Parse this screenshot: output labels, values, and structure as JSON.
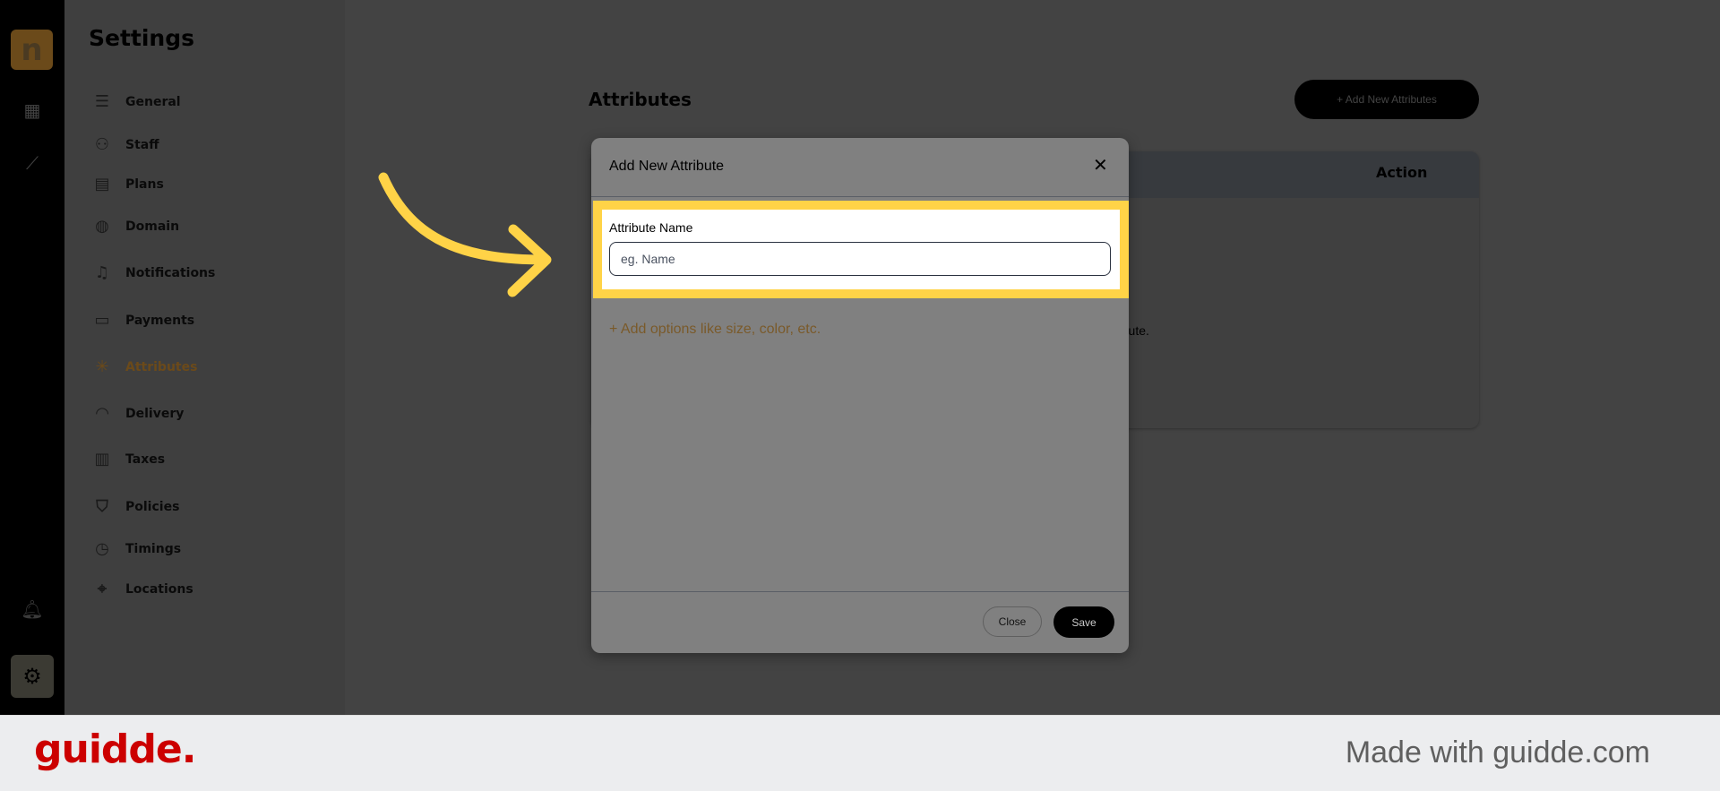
{
  "rail": {
    "icons": [
      "logo",
      "store-icon",
      "chart-icon",
      "bell-icon",
      "gear-icon"
    ]
  },
  "settings": {
    "title": "Settings",
    "items": [
      {
        "label": "General",
        "icon": "sliders-icon"
      },
      {
        "label": "Staff",
        "icon": "users-icon"
      },
      {
        "label": "Plans",
        "icon": "plans-icon"
      },
      {
        "label": "Domain",
        "icon": "globe-icon"
      },
      {
        "label": "Notifications",
        "icon": "bell-icon"
      },
      {
        "label": "Payments",
        "icon": "wallet-icon"
      },
      {
        "label": "Attributes",
        "icon": "snowflake-icon",
        "active": true
      },
      {
        "label": "Delivery",
        "icon": "bag-icon"
      },
      {
        "label": "Taxes",
        "icon": "receipt-icon"
      },
      {
        "label": "Policies",
        "icon": "shield-icon"
      },
      {
        "label": "Timings",
        "icon": "clock-icon"
      },
      {
        "label": "Locations",
        "icon": "map-pin-icon"
      }
    ]
  },
  "main": {
    "title": "Attributes",
    "add_button": "+ Add New Attributes",
    "table_header_action": "Action",
    "empty_text_fragment": "ribute."
  },
  "dialog": {
    "title": "Add New Attribute",
    "close_icon": "✕",
    "field_label": "Attribute Name",
    "field_placeholder": "eg. Name",
    "field_value": "",
    "add_options": "+ Add options like size, color, etc.",
    "close_label": "Close",
    "save_label": "Save"
  },
  "colors": {
    "highlight": "#ffd347",
    "accent": "#d79a3a",
    "guidde": "#cc0000"
  },
  "footer": {
    "logo": "guidde.",
    "made_with": "Made with guidde.com"
  }
}
